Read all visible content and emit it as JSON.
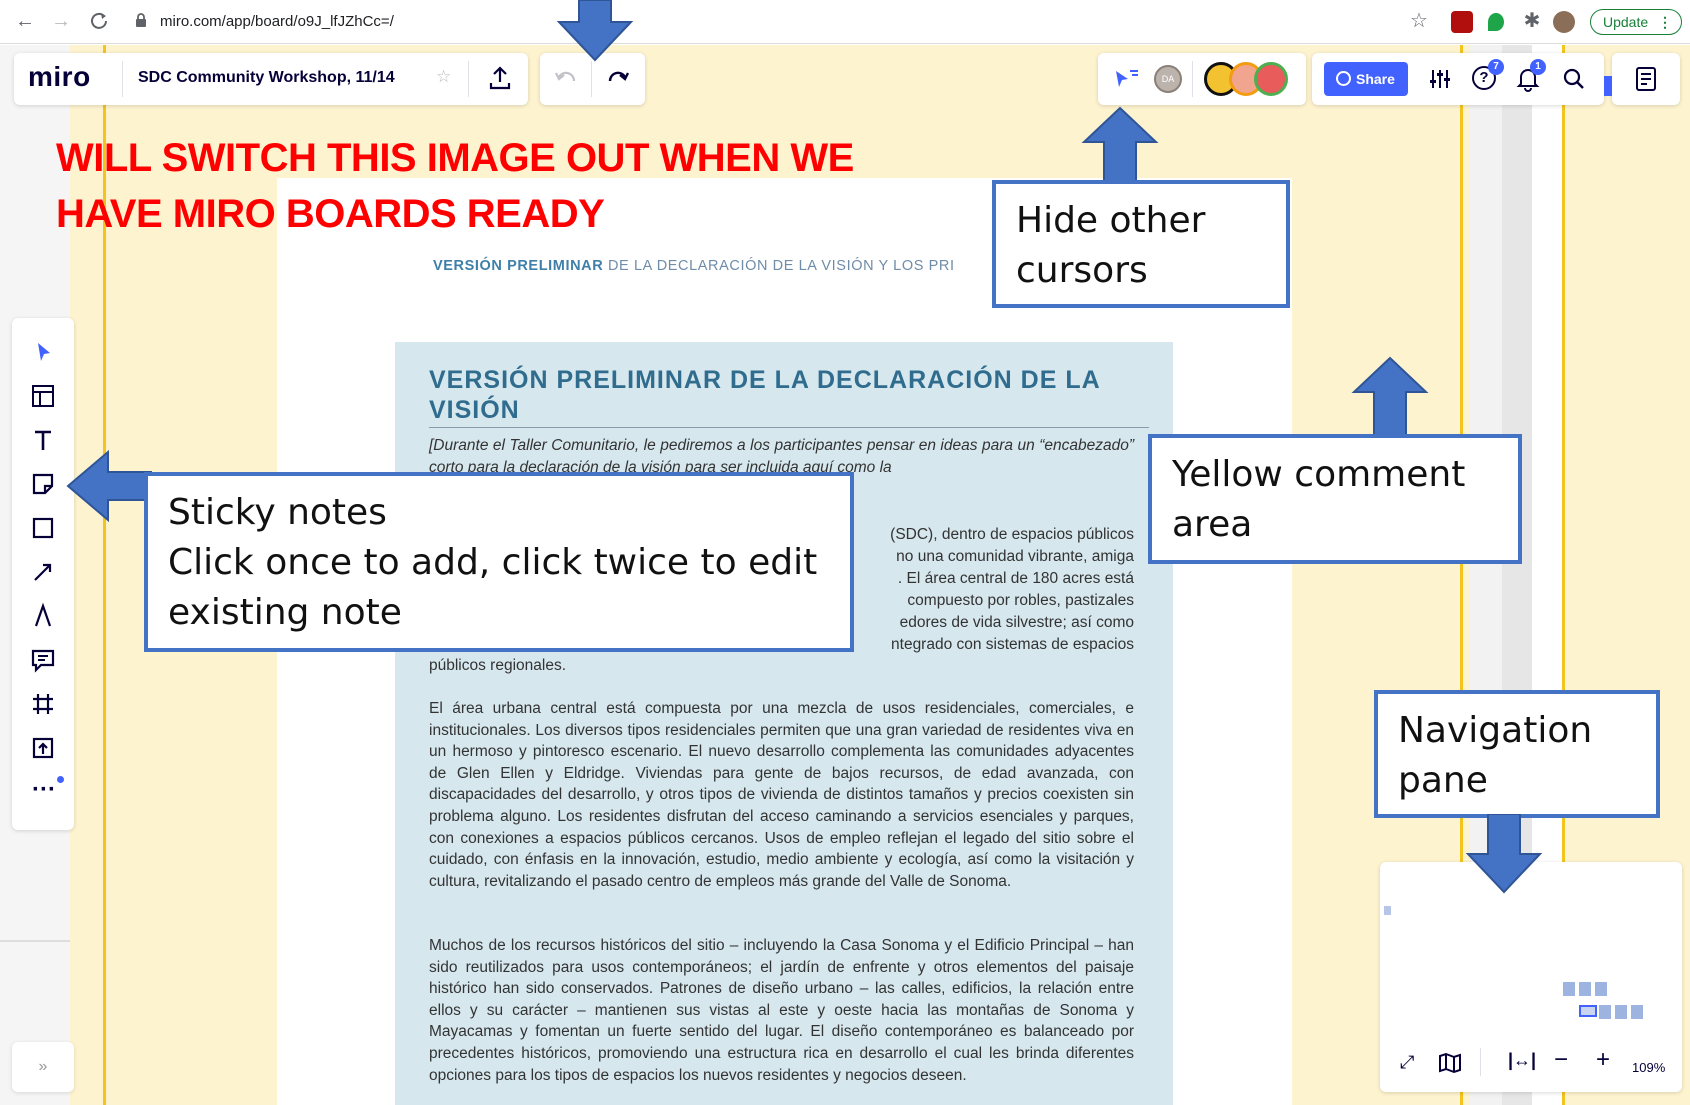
{
  "browser": {
    "url": "miro.com/app/board/o9J_lfJZhCc=/",
    "update_label": "Update"
  },
  "miro": {
    "logo": "miro",
    "board_title": "SDC Community Workshop, 11/14",
    "share_label": "Share",
    "help_badge": "7",
    "notif_badge": "1",
    "avatar_initials": "DA",
    "zoom": "109%",
    "expand_label": "»"
  },
  "document": {
    "header_bold": "VERSIÓN PRELIMINAR",
    "header_rest": "DE LA DECLARACIÓN DE LA VISIÓN Y LOS PRI",
    "title": "VERSIÓN PRELIMINAR DE LA DECLARACIÓN DE LA VISIÓN",
    "intro_italic": "[Durante el Taller Comunitario, le pediremos a los participantes pensar en ideas para un “encabezado” corto para la declaración de la visión para ser incluida aquí como la",
    "para1_lines": [
      "(SDC), dentro de espacios públicos",
      "no una comunidad vibrante, amiga",
      ". El área central de 180 acres está",
      "compuesto por robles, pastizales",
      "edores de vida silvestre; así como",
      "ntegrado con sistemas de espacios"
    ],
    "para1_end": "públicos regionales.",
    "para2": "El área urbana central está compuesta por una mezcla de usos residenciales, comerciales, e institucionales. Los diversos tipos residenciales permiten que una gran variedad de residentes viva en un hermoso y pintoresco escenario. El nuevo desarrollo complementa las comunidades adyacentes de Glen Ellen y Eldridge. Viviendas para gente de bajos recursos, de edad avanzada, con discapacidades del desarrollo, y otros tipos de vivienda de distintos tamaños y precios coexisten sin problema alguno. Los residentes disfrutan del acceso caminando a servicios esenciales y parques, con conexiones a espacios públicos cercanos. Usos de empleo reflejan el legado del sitio sobre el cuidado, con énfasis en la innovación, estudio, medio ambiente y ecología, así como la visitación y cultura, revitalizando el pasado centro de empleos más grande del Valle de Sonoma.",
    "para3": "Muchos de los recursos históricos del sitio – incluyendo la Casa Sonoma y el Edificio Principal – han sido reutilizados para usos contemporáneos; el jardín de enfrente y otros elementos del paisaje histórico han sido conservados. Patrones de diseño urbano – las calles, edificios, la relación entre ellos y su carácter – mantienen sus vistas al este y oeste hacia las montañas de Sonoma y Mayacamas y fomentan un fuerte sentido del lugar. El diseño contemporáneo es balanceado por precedentes históricos, promoviendo una estructura rica en desarrollo el cual les brinda diferentes opciones para los tipos de espacios los nuevos residentes y negocios deseen."
  },
  "annotations": {
    "red_line1": "WILL SWITCH THIS IMAGE OUT WHEN WE",
    "red_line2": "HAVE MIRO BOARDS READY",
    "hide_cursors": [
      "Hide other",
      "cursors"
    ],
    "yellow_comment": [
      "Yellow comment",
      "area"
    ],
    "sticky_notes": [
      "Sticky notes",
      "Click once to add, click twice to edit",
      "existing note"
    ],
    "navigation": [
      "Navigation",
      "pane"
    ]
  },
  "colors": {
    "accent": "#4262ff",
    "callout_border": "#4472c4",
    "red_note": "#ff0000",
    "yellow_band": "#fdf3cf"
  }
}
